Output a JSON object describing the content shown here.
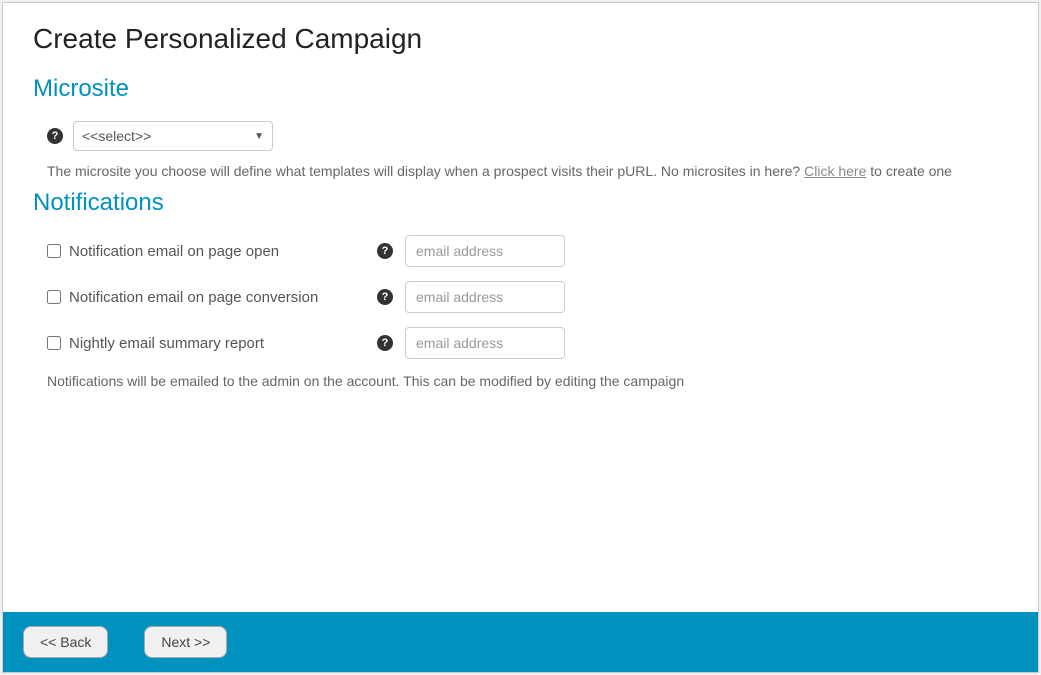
{
  "page_title": "Create Personalized Campaign",
  "microsite": {
    "title": "Microsite",
    "select_placeholder": "<<select>>",
    "helper_pre": "The microsite you choose will define what templates will display when a prospect visits their pURL. No microsites in here? ",
    "helper_link": "Click here",
    "helper_post": " to create one"
  },
  "notifications": {
    "title": "Notifications",
    "rows": [
      {
        "label": "Notification email on page open",
        "placeholder": "email address"
      },
      {
        "label": "Notification email on page conversion",
        "placeholder": "email address"
      },
      {
        "label": "Nightly email summary report",
        "placeholder": "email address"
      }
    ],
    "helper": "Notifications will be emailed to the admin on the account. This can be modified by editing the campaign"
  },
  "footer": {
    "back": "<< Back",
    "next": "Next >>"
  }
}
